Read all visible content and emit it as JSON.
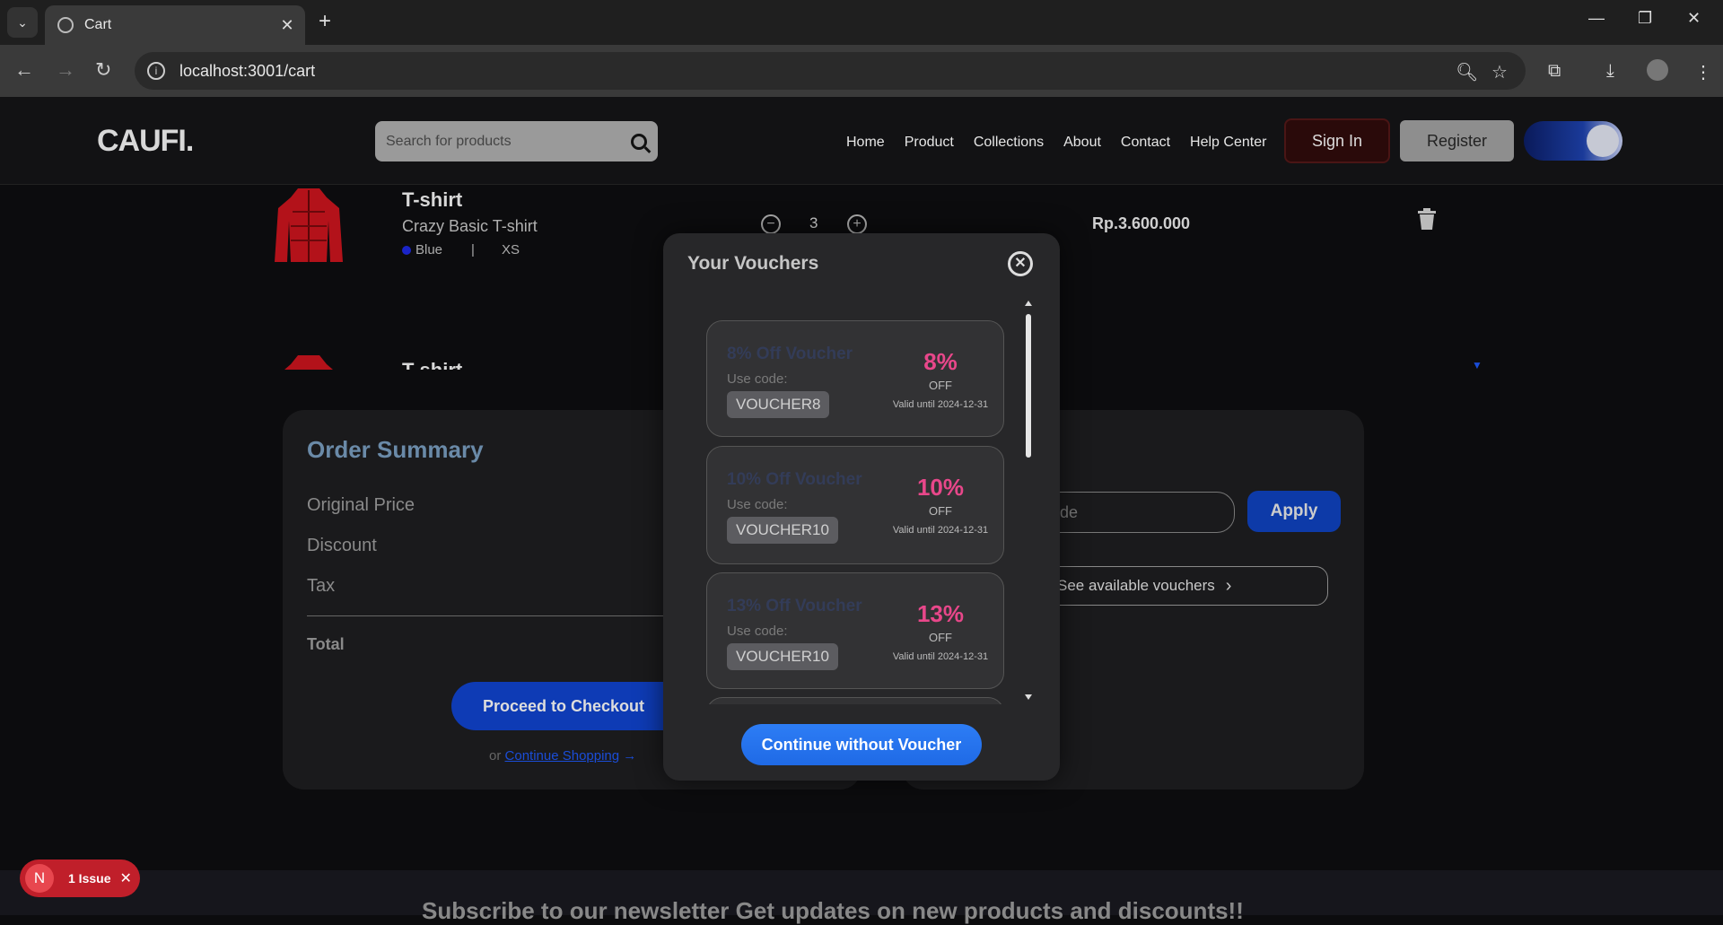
{
  "browser": {
    "tab_title": "Cart",
    "url": "localhost:3001/cart"
  },
  "header": {
    "logo": "CAUFI.",
    "search_placeholder": "Search for products",
    "nav": [
      "Home",
      "Product",
      "Collections",
      "About",
      "Contact",
      "Help Center"
    ],
    "signin_label": "Sign In",
    "register_label": "Register"
  },
  "cart": {
    "items": [
      {
        "name": "T-shirt",
        "desc": "Crazy Basic T-shirt",
        "color": "Blue",
        "size": "XS",
        "qty": "3",
        "price": "Rp.3.600.000"
      },
      {
        "name": "T-shirt"
      }
    ]
  },
  "order_summary": {
    "title": "Order Summary",
    "rows": [
      "Original Price",
      "Discount",
      "Tax"
    ],
    "total_label": "Total",
    "checkout_label": "Proceed to Checkout",
    "or_label": "or",
    "continue_label": "Continue Shopping"
  },
  "voucher_panel": {
    "input_placeholder": "ode",
    "apply_label": "Apply",
    "see_label": "See available vouchers"
  },
  "modal": {
    "title": "Your Vouchers",
    "vouchers": [
      {
        "name": "8% Off Voucher",
        "use": "Use code:",
        "code": "VOUCHER8",
        "pct": "8%",
        "off": "OFF",
        "valid": "Valid until 2024-12-31"
      },
      {
        "name": "10% Off Voucher",
        "use": "Use code:",
        "code": "VOUCHER10",
        "pct": "10%",
        "off": "OFF",
        "valid": "Valid until 2024-12-31"
      },
      {
        "name": "13% Off Voucher",
        "use": "Use code:",
        "code": "VOUCHER10",
        "pct": "13%",
        "off": "OFF",
        "valid": "Valid until 2024-12-31"
      }
    ],
    "continue_label": "Continue without Voucher"
  },
  "footer": {
    "newsletter": "Subscribe to our newsletter Get updates on new products and discounts!!"
  },
  "dev_overlay": {
    "letter": "N",
    "issues_label": "1 Issue"
  },
  "colors": {
    "accent_blue": "#0e3bb5",
    "voucher_pink": "#e8478a",
    "issue_red": "#c01f2a"
  }
}
